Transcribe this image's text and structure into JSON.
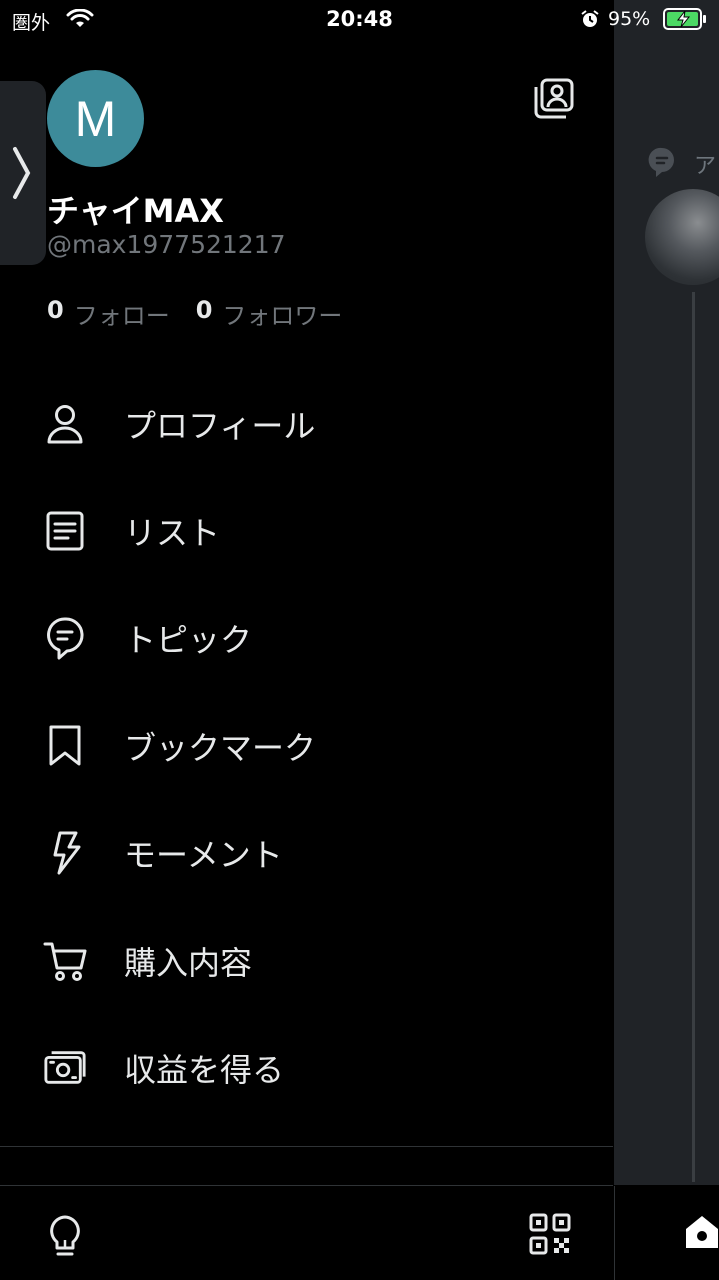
{
  "status_bar": {
    "carrier": "圏外",
    "time": "20:48",
    "battery_percent": "95%"
  },
  "profile": {
    "avatar_letter": "M",
    "avatar_color": "#3d8b9a",
    "display_name": "チャイMAX",
    "handle": "@max1977521217",
    "following_count": "0",
    "following_label": "フォロー",
    "followers_count": "0",
    "followers_label": "フォロワー"
  },
  "menu": {
    "items": [
      {
        "label": "プロフィール",
        "icon": "person-icon"
      },
      {
        "label": "リスト",
        "icon": "list-icon"
      },
      {
        "label": "トピック",
        "icon": "topic-icon"
      },
      {
        "label": "ブックマーク",
        "icon": "bookmark-icon"
      },
      {
        "label": "モーメント",
        "icon": "lightning-icon"
      },
      {
        "label": "購入内容",
        "icon": "cart-icon"
      },
      {
        "label": "収益を得る",
        "icon": "money-icon"
      }
    ]
  },
  "background_peek": {
    "topic_letter": "ア"
  }
}
